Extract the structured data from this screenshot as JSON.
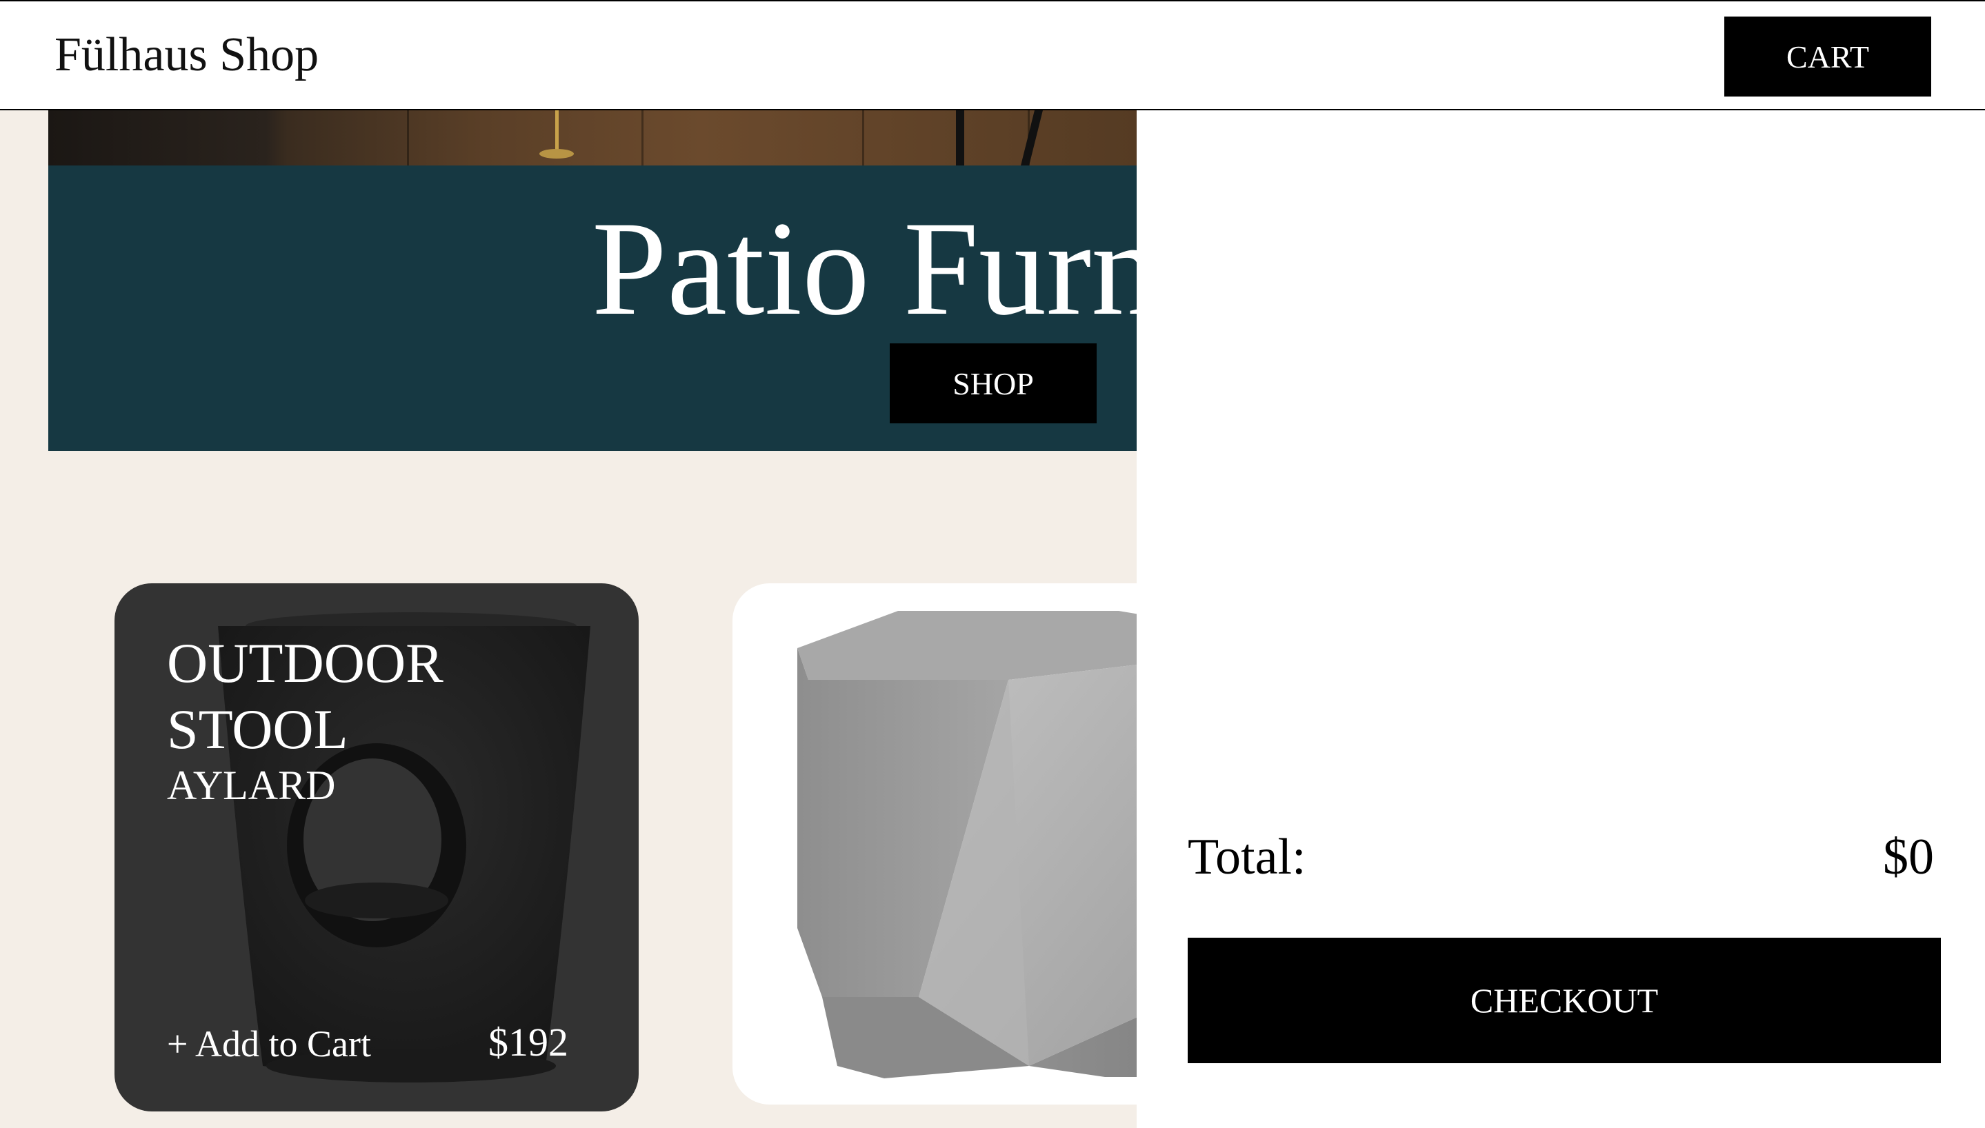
{
  "header": {
    "brand": "Fülhaus Shop",
    "cart_label": "CART"
  },
  "hero": {
    "title": "Patio Furn",
    "shop_label": "SHOP"
  },
  "products": [
    {
      "name": "OUTDOOR STOOL",
      "subtitle": "AYLARD",
      "add_to_cart": "+ Add to Cart",
      "price": "$192",
      "image": "dark-concrete-stool-with-hole"
    },
    {
      "image": "grey-concrete-hexagonal-stool"
    }
  ],
  "cart": {
    "total_label": "Total:",
    "total_value": "$0",
    "checkout_label": "CHECKOUT"
  },
  "colors": {
    "background": "#f4eee7",
    "banner": "#163842",
    "dark_card": "#333333",
    "button": "#000000"
  }
}
